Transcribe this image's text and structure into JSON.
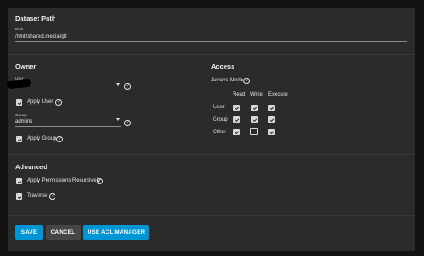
{
  "dataset_path": {
    "title": "Dataset Path",
    "field_label": "Path",
    "value": "/mnt/shared.media/git"
  },
  "owner": {
    "title": "Owner",
    "user_label": "User",
    "user_value": "",
    "apply_user_label": "Apply User",
    "apply_user_checked": true,
    "group_label": "Group",
    "group_value": "admins",
    "apply_group_label": "Apply Group",
    "apply_group_checked": true
  },
  "access": {
    "title": "Access",
    "mode_label": "Access Mode",
    "columns": [
      "Read",
      "Write",
      "Execute"
    ],
    "rows": [
      {
        "label": "User",
        "values": [
          true,
          true,
          true
        ]
      },
      {
        "label": "Group",
        "values": [
          true,
          true,
          true
        ]
      },
      {
        "label": "Other",
        "values": [
          true,
          false,
          true
        ]
      }
    ]
  },
  "advanced": {
    "title": "Advanced",
    "recursive_label": "Apply Permissions Recursively",
    "recursive_checked": true,
    "traverse_label": "Traverse",
    "traverse_checked": true
  },
  "buttons": {
    "save": "SAVE",
    "cancel": "CANCEL",
    "acl": "USE ACL MANAGER"
  },
  "colors": {
    "accent": "#0095d5",
    "panel": "#2b2b2b",
    "background": "#121212"
  }
}
